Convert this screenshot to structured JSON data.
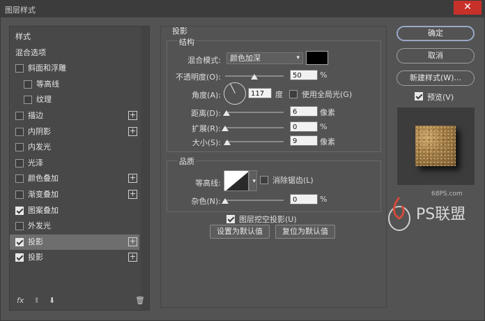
{
  "window": {
    "title": "图层样式",
    "close_glyph": "✕"
  },
  "left": {
    "items": [
      {
        "label": "样式",
        "checkbox": false,
        "checked": false,
        "plus": false,
        "selected": false,
        "indent": 0
      },
      {
        "label": "混合选项",
        "checkbox": false,
        "checked": false,
        "plus": false,
        "selected": false,
        "indent": 0
      },
      {
        "label": "斜面和浮雕",
        "checkbox": true,
        "checked": false,
        "plus": false,
        "selected": false,
        "indent": 0
      },
      {
        "label": "等高线",
        "checkbox": true,
        "checked": false,
        "plus": false,
        "selected": false,
        "indent": 1
      },
      {
        "label": "纹理",
        "checkbox": true,
        "checked": false,
        "plus": false,
        "selected": false,
        "indent": 1
      },
      {
        "label": "描边",
        "checkbox": true,
        "checked": false,
        "plus": true,
        "selected": false,
        "indent": 0
      },
      {
        "label": "内阴影",
        "checkbox": true,
        "checked": false,
        "plus": true,
        "selected": false,
        "indent": 0
      },
      {
        "label": "内发光",
        "checkbox": true,
        "checked": false,
        "plus": false,
        "selected": false,
        "indent": 0
      },
      {
        "label": "光泽",
        "checkbox": true,
        "checked": false,
        "plus": false,
        "selected": false,
        "indent": 0
      },
      {
        "label": "颜色叠加",
        "checkbox": true,
        "checked": false,
        "plus": true,
        "selected": false,
        "indent": 0
      },
      {
        "label": "渐变叠加",
        "checkbox": true,
        "checked": false,
        "plus": true,
        "selected": false,
        "indent": 0
      },
      {
        "label": "图案叠加",
        "checkbox": true,
        "checked": true,
        "plus": false,
        "selected": false,
        "indent": 0
      },
      {
        "label": "外发光",
        "checkbox": true,
        "checked": false,
        "plus": false,
        "selected": false,
        "indent": 0
      },
      {
        "label": "投影",
        "checkbox": true,
        "checked": true,
        "plus": true,
        "selected": true,
        "indent": 0
      },
      {
        "label": "投影",
        "checkbox": true,
        "checked": true,
        "plus": true,
        "selected": false,
        "indent": 0
      }
    ],
    "bottom": {
      "fx": "fx",
      "up": "⬆",
      "down": "⬇",
      "trash": "🗑"
    }
  },
  "main": {
    "section_title": "投影",
    "structure_title": "结构",
    "blend_mode_label": "混合模式:",
    "blend_mode_value": "颜色加深",
    "blend_color": "#000000",
    "opacity_label": "不透明度(O):",
    "opacity_value": "50",
    "opacity_fraction": 0.5,
    "percent": "%",
    "angle_label": "角度(A):",
    "angle_value": "117",
    "angle_unit": "度",
    "global_light_label": "使用全局光(G)",
    "global_light_checked": false,
    "distance_label": "距离(D):",
    "distance_value": "6",
    "distance_fraction": 0.02,
    "px_unit": "像素",
    "spread_label": "扩展(R):",
    "spread_value": "0",
    "spread_fraction": 0,
    "size_label": "大小(S):",
    "size_value": "9",
    "size_fraction": 0.03,
    "quality_title": "品质",
    "contour_label": "等高线:",
    "antialias_label": "消除锯齿(L)",
    "antialias_checked": false,
    "noise_label": "杂色(N):",
    "noise_value": "0",
    "noise_fraction": 0,
    "knockout_label": "图层挖空投影(U)",
    "knockout_checked": true,
    "set_default": "设置为默认值",
    "reset_default": "复位为默认值"
  },
  "right": {
    "ok": "确定",
    "cancel": "取消",
    "new_style": "新建样式(W)...",
    "preview_label": "预览(V)",
    "preview_checked": true
  },
  "watermark": {
    "site": "68PS.com",
    "brand": "PS联盟"
  }
}
